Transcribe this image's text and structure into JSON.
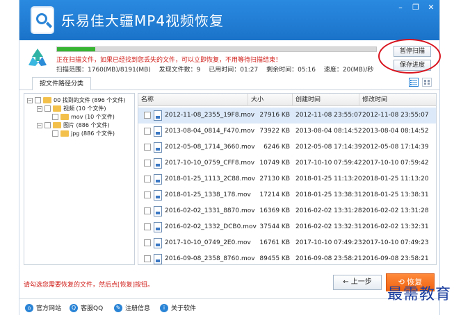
{
  "app": {
    "title": "乐易佳大疆MP4视频恢复",
    "controls": {
      "minimize": "–",
      "maximize": "❐",
      "close": "✕"
    }
  },
  "scan": {
    "progress": 0.12,
    "message": "正在扫描文件，如果已经找到您丢失的文件，可以立即恢复，不用等待扫描结束！",
    "range": "扫描范围：1760(MB)/8191(MB)",
    "found": "发现文件数：9",
    "elapsed": "已用时间：01:27",
    "remaining": "剩余时间：05:16",
    "speed": "速度：20(MB)/秒",
    "pause_label": "暂停扫描",
    "save_label": "保存进度"
  },
  "tabs": {
    "path_tab": "按文件路径分类"
  },
  "tree": {
    "root": "00 找到的文件  (896 个文件)",
    "video": "视频    (10 个文件)",
    "mov": "mov    (10 个文件)",
    "image": "图片    (886 个文件)",
    "jpg": "jpg    (886 个文件)"
  },
  "list": {
    "columns": {
      "name": "名称",
      "size": "大小",
      "created": "创建时间",
      "modified": "修改时间"
    },
    "rows": [
      {
        "name": "2012-11-08_2355_19F8.mov",
        "size": "27916 KB",
        "created": "2012-11-08  23:55:07",
        "modified": "2012-11-08  23:55:07"
      },
      {
        "name": "2013-08-04_0814_F470.mov",
        "size": "73922 KB",
        "created": "2013-08-04  08:14:52",
        "modified": "2013-08-04  08:14:52"
      },
      {
        "name": "2012-05-08_1714_3660.mov",
        "size": "6246 KB",
        "created": "2012-05-08  17:14:39",
        "modified": "2012-05-08  17:14:39"
      },
      {
        "name": "2017-10-10_0759_CFF8.mov",
        "size": "10749 KB",
        "created": "2017-10-10  07:59:42",
        "modified": "2017-10-10  07:59:42"
      },
      {
        "name": "2018-01-25_1113_2C88.mov",
        "size": "27130 KB",
        "created": "2018-01-25  11:13:20",
        "modified": "2018-01-25  11:13:20"
      },
      {
        "name": "2018-01-25_1338_178.mov",
        "size": "17214 KB",
        "created": "2018-01-25  13:38:31",
        "modified": "2018-01-25  13:38:31"
      },
      {
        "name": "2016-02-02_1331_8870.mov",
        "size": "16369 KB",
        "created": "2016-02-02  13:31:28",
        "modified": "2016-02-02  13:31:28"
      },
      {
        "name": "2016-02-02_1332_DCB0.mov",
        "size": "37544 KB",
        "created": "2016-02-02  13:32:31",
        "modified": "2016-02-02  13:32:31"
      },
      {
        "name": "2017-10-10_0749_2E0.mov",
        "size": "16761 KB",
        "created": "2017-10-10  07:49:23",
        "modified": "2017-10-10  07:49:23"
      },
      {
        "name": "2016-09-08_2358_8760.mov",
        "size": "89455 KB",
        "created": "2016-09-08  23:58:21",
        "modified": "2016-09-08  23:58:21"
      }
    ]
  },
  "bottom": {
    "instruction": "请勾选您需要恢复的文件，然后点[恢复]按钮。",
    "prev_label": "← 上一步",
    "recover_label": "⟲ 恢复"
  },
  "footer": {
    "website": "官方网站",
    "qq": "客服QQ",
    "register": "注册信息",
    "about": "关于软件"
  },
  "watermark": "最需教育",
  "colors": {
    "title_bar": "#1a73c9",
    "accent_red": "#d0201b",
    "progress_green": "#37b432",
    "recover_orange": "#f06312"
  },
  "icons": [
    "app-logo-icon",
    "recycle-icon",
    "list-view-icon",
    "grid-view-icon",
    "folder-icon",
    "mov-file-icon",
    "home-icon",
    "qq-icon",
    "register-icon",
    "about-icon"
  ]
}
